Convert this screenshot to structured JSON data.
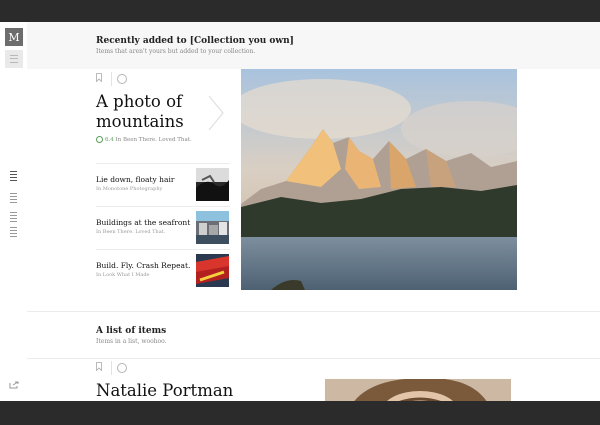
{
  "nav": {
    "logo": "M"
  },
  "collection_header": {
    "title": "Recently added to [Collection you own]",
    "subtitle": "Items that aren't yours but added to your collection."
  },
  "feature": {
    "title": "A photo of mountains",
    "score": "6.4",
    "meta_prefix": "In",
    "meta_collection": "Been There. Loved That."
  },
  "posts": [
    {
      "title": "Lie down, floaty hair",
      "meta": "In Monotone Photography"
    },
    {
      "title": "Buildings at the seafront",
      "meta": "In Been There. Loved That."
    },
    {
      "title": "Build. Fly. Crash Repeat.",
      "meta": "In Look What I Made"
    }
  ],
  "list_header": {
    "title": "A list of items",
    "subtitle": "Items in a list, woohoo."
  },
  "next_post": {
    "title": "Natalie Portman"
  },
  "colors": {
    "accent_green": "#5aa05a",
    "frame": "#2b2b2b",
    "header_bg": "#f7f7f7"
  },
  "icons": [
    "m-logo-icon",
    "menu-icon",
    "bookmark-icon",
    "circle-icon",
    "chevron-right-icon",
    "score-icon",
    "share-icon"
  ]
}
